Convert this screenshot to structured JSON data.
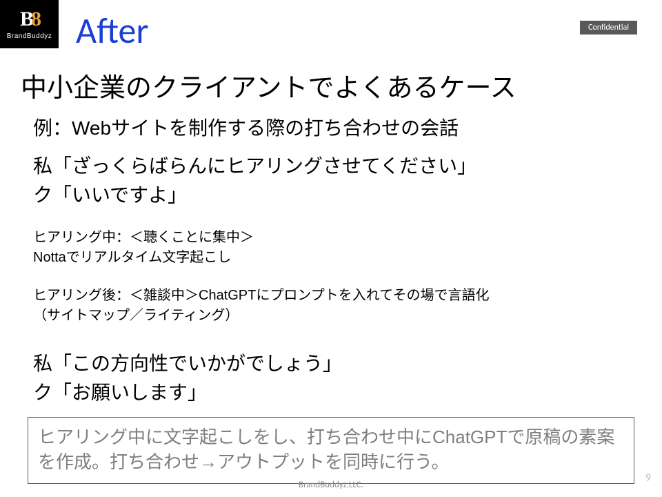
{
  "logo": {
    "brand": "BrandBuddyz"
  },
  "header": {
    "title": "After",
    "badge": "Confidential"
  },
  "content": {
    "heading": "中小企業のクライアントでよくあるケース",
    "subheading": "例：Webサイトを制作する際の打ち合わせの会話",
    "dialog1_line1": "私「ざっくらばらんにヒアリングさせてください」",
    "dialog1_line2": "ク「いいですよ」",
    "during_line1": "ヒアリング中：＜聴くことに集中＞",
    "during_line2": "Nottaでリアルタイム文字起こし",
    "after_line1": "ヒアリング後：＜雑談中＞ChatGPTにプロンプトを入れてその場で言語化",
    "after_line2": "（サイトマップ／ライティング）",
    "dialog2_line1": "私「この方向性でいかがでしょう」",
    "dialog2_line2": "ク「お願いします」",
    "summary": "ヒアリング中に文字起こしをし、打ち合わせ中にChatGPTで原稿の素案を作成。打ち合わせ→アウトプットを同時に行う。"
  },
  "footer": {
    "company": "BrandBuddyz,LLC.",
    "page": "9"
  }
}
